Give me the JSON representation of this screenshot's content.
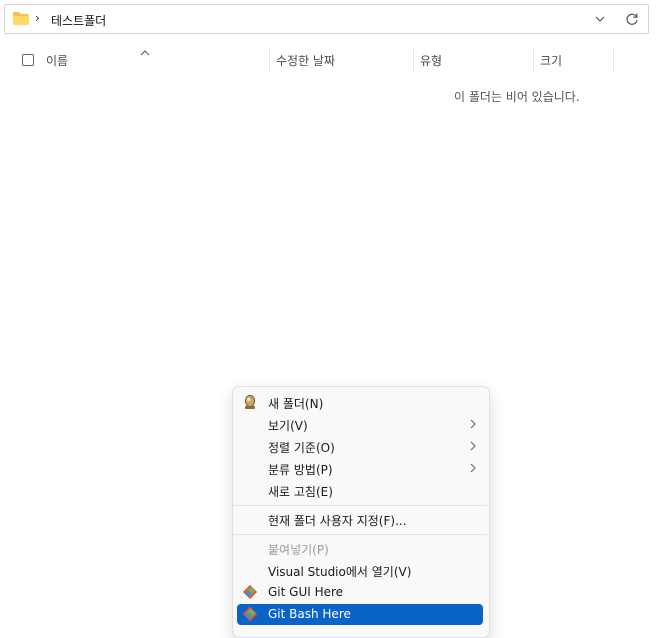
{
  "address_bar": {
    "breadcrumb_sep": "›",
    "folder": "테스트폴더"
  },
  "columns": {
    "name": "이름",
    "modified": "수정한 날짜",
    "type": "유형",
    "size": "크기"
  },
  "empty_message": "이 폴더는 비어 있습니다.",
  "context_menu": {
    "new_folder": "새 폴더(N)",
    "view": "보기(V)",
    "sort_by": "정렬 기준(O)",
    "group_by": "분류 방법(P)",
    "refresh": "새로 고침(E)",
    "customize": "현재 폴더 사용자 지정(F)...",
    "paste": "붙여넣기(P)",
    "open_vs": "Visual Studio에서 열기(V)",
    "git_gui": "Git GUI Here",
    "git_bash": "Git Bash Here"
  },
  "colors": {
    "accent": "#0a64c8",
    "folder": "#f4c542",
    "git": "#e8573a"
  },
  "icons": [
    "folder-icon",
    "chevron-down-icon",
    "refresh-icon",
    "sort-caret-icon",
    "new-folder-icon",
    "submenu-chevron-icon",
    "git-icon"
  ]
}
